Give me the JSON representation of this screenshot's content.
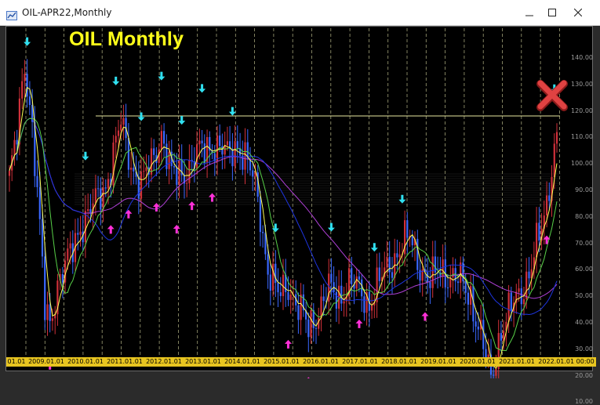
{
  "window": {
    "title": "OIL-APR22,Monthly",
    "icons": {
      "app": "chart-icon",
      "minimize": "minimize-icon",
      "maximize": "maximize-icon",
      "close": "close-icon"
    }
  },
  "chart": {
    "title": "OIL Monthly",
    "close_marker": "red-x-icon"
  },
  "price_axis": [
    "140.00",
    "130.00",
    "120.00",
    "110.00",
    "100.00",
    "90.00",
    "80.00",
    "70.00",
    "60.00",
    "50.00",
    "40.00",
    "30.00",
    "20.00",
    "10.00"
  ],
  "date_axis": [
    "01.01",
    "2009.01.01",
    "2010.01.01",
    "2011.01.01",
    "2012.01.01",
    "2013.01.01",
    "2014.01.01",
    "2015.01.01",
    "2016.01.01",
    "2017.01.01",
    "2018.01.01",
    "2019.01.01",
    "2020.01.01",
    "2021.01.01",
    "2022.01.01 00:00"
  ],
  "colors": {
    "background": "#000000",
    "title": "#ffff1a",
    "grid": "#d8d8a0",
    "axis_date_bg": "#e8c520",
    "candle_up": "#d0303a",
    "candle_down": "#3a68ff",
    "signal_down_arrow": "#30e0f0",
    "signal_up_arrow": "#ff30d8",
    "ma_yellow": "#ffff55",
    "ma_green": "#58d048",
    "ma_blue": "#1e35e0",
    "ma_purple": "#b040d8",
    "resistance_line": "#e8e8a0"
  }
}
